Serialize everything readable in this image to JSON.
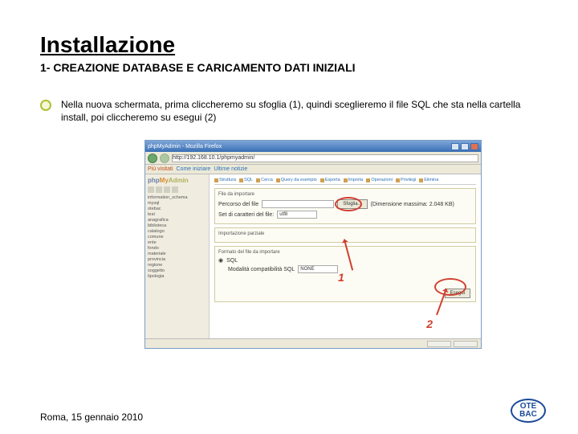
{
  "title": "Installazione",
  "subtitle": "1- CREAZIONE DATABASE E CARICAMENTO DATI INIZIALI",
  "body": "Nella nuova schermata, prima cliccheremo su sfoglia (1), quindi sceglieremo il file SQL che sta nella cartella install, poi cliccheremo su esegui (2)",
  "footer_text": "Roma, 15 gennaio 2010",
  "logo": {
    "line1": "OTE",
    "line2": "BAC"
  },
  "screenshot": {
    "window_title": "phpMyAdmin - Mozilla Firefox",
    "address": "http://192.168.10.1/phpmyadmin/",
    "bookmarks": [
      "Più visitati",
      "Come iniziare",
      "Ultime notizie"
    ],
    "pma_logo": {
      "php": "php",
      "my": "My",
      "admin": "Admin"
    },
    "side_items": [
      "information_schema",
      "mysql",
      "otebac",
      "test",
      "anagrafica",
      "biblioteca",
      "catalogo",
      "comune",
      "ente",
      "fondo",
      "materiale",
      "provincia",
      "regione",
      "soggetto",
      "tipologia"
    ],
    "tabs": [
      "Struttura",
      "SQL",
      "Cerca",
      "Query da esempio",
      "Esporta",
      "Importa",
      "Operazioni",
      "Privilegi",
      "Elimina"
    ],
    "import_legend": "File da importare",
    "file_label": "Percorso del file",
    "sfoglia_btn": "Sfoglia...",
    "max_label": "(Dimensione massima: 2.048 KB)",
    "charset_label": "Set di caratteri del file:",
    "charset_value": "utf8",
    "partial_legend": "Importazione parziale",
    "format_legend": "Formato del file da importare",
    "sql_radio": "SQL",
    "sql_opts": "Modalità compatibilità SQL",
    "none_value": "NONE",
    "esegui_btn": "Esegui",
    "callout1": "1",
    "callout2": "2"
  }
}
